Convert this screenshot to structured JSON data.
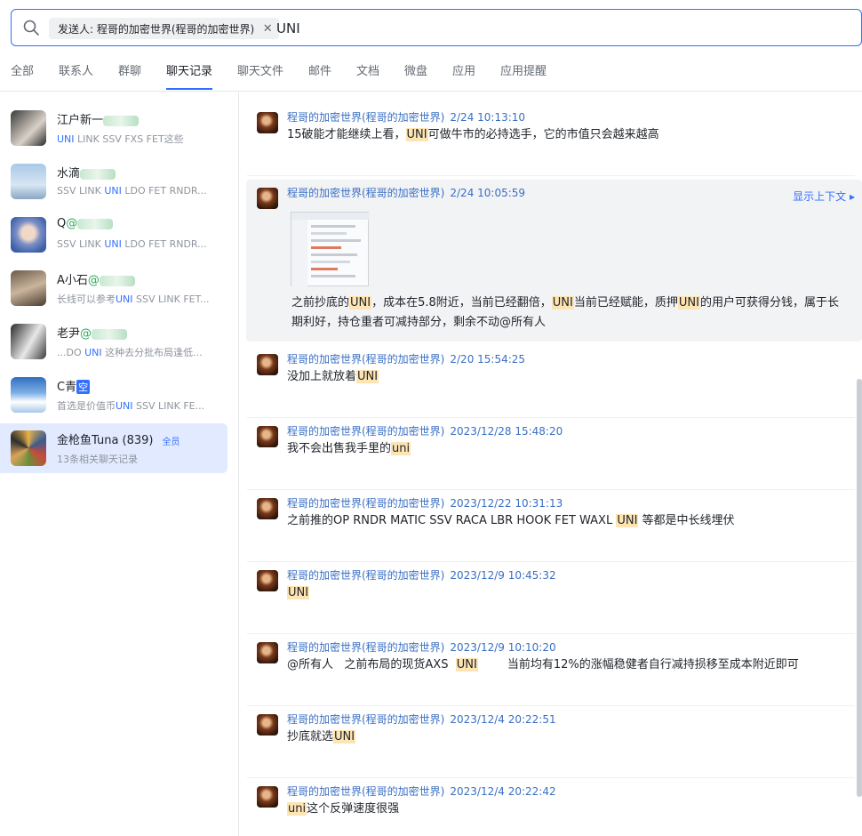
{
  "search": {
    "chip_label": "发送人: 程哥的加密世界(程哥的加密世界)",
    "query": "UNI"
  },
  "tabs": [
    {
      "label": "全部"
    },
    {
      "label": "联系人"
    },
    {
      "label": "群聊"
    },
    {
      "label": "聊天记录",
      "active": true
    },
    {
      "label": "聊天文件"
    },
    {
      "label": "邮件"
    },
    {
      "label": "文档"
    },
    {
      "label": "微盘"
    },
    {
      "label": "应用"
    },
    {
      "label": "应用提醒"
    }
  ],
  "contacts": [
    {
      "name": "江户新一",
      "sub": "UNI  LINK SSV FXS  FET这些"
    },
    {
      "name": "水滴",
      "sub": "SSV LINK  UNI LDO  FET RNDR..."
    },
    {
      "name": "Q",
      "name_suffix": "@",
      "sub": "SSV LINK  UNI LDO  FET RNDR..."
    },
    {
      "name": "A小石",
      "name_suffix": "@",
      "sub": "长线可以参考UNI  SSV LINK FET..."
    },
    {
      "name": "老尹",
      "name_suffix": "@",
      "sub": "...DO  UNI  这种去分批布局逢低..."
    },
    {
      "name": "C青",
      "name_tag": "空",
      "sub": "首选是价值币UNI SSV  LINK  FE..."
    },
    {
      "name": "金枪鱼Tuna (839)",
      "badge": "全员",
      "sub": "13条相关聊天记录"
    }
  ],
  "sender": "程哥的加密世界(程哥的加密世界)",
  "context_link": "显示上下文 ▸",
  "messages": [
    {
      "time": "2/24 10:13:10",
      "parts": [
        "15破能才能继续上看，",
        "UNI",
        "可做牛市的必持选手，它的市值只会越来越高"
      ]
    },
    {
      "time": "2/24 10:05:59",
      "parts": [
        "之前抄底的",
        "UNI",
        "，成本在5.8附近，当前已经翻倍，",
        "UNI",
        "当前已经赋能，质押",
        "UNI",
        "的用户可获得分钱，属于长"
      ],
      "line2": "期利好，持仓重者可减持部分，剩余不动@所有人"
    },
    {
      "time": "2/20 15:54:25",
      "parts": [
        "没加上就放着",
        "UNI"
      ]
    },
    {
      "time": "2023/12/28 15:48:20",
      "parts": [
        "我不会出售我手里的",
        "uni"
      ]
    },
    {
      "time": "2023/12/22 10:31:13",
      "parts": [
        "之前推的OP  RNDR  MATIC  SSV  RACA LBR  HOOK  FET  WAXL  ",
        "UNI",
        " 等都是中长线埋伏"
      ]
    },
    {
      "time": "2023/12/9 10:45:32",
      "parts": [
        "",
        "UNI"
      ]
    },
    {
      "time": "2023/12/9 10:10:20",
      "parts": [
        "@所有人   之前布局的现货AXS  ",
        "UNI",
        "        当前均有12%的涨幅稳健者自行减持损移至成本附近即可"
      ]
    },
    {
      "time": "2023/12/4 20:22:51",
      "parts": [
        "抄底就选",
        "UNI"
      ]
    },
    {
      "time": "2023/12/4 20:22:42",
      "parts": [
        "",
        "uni",
        "这个反弹速度很强"
      ]
    }
  ]
}
